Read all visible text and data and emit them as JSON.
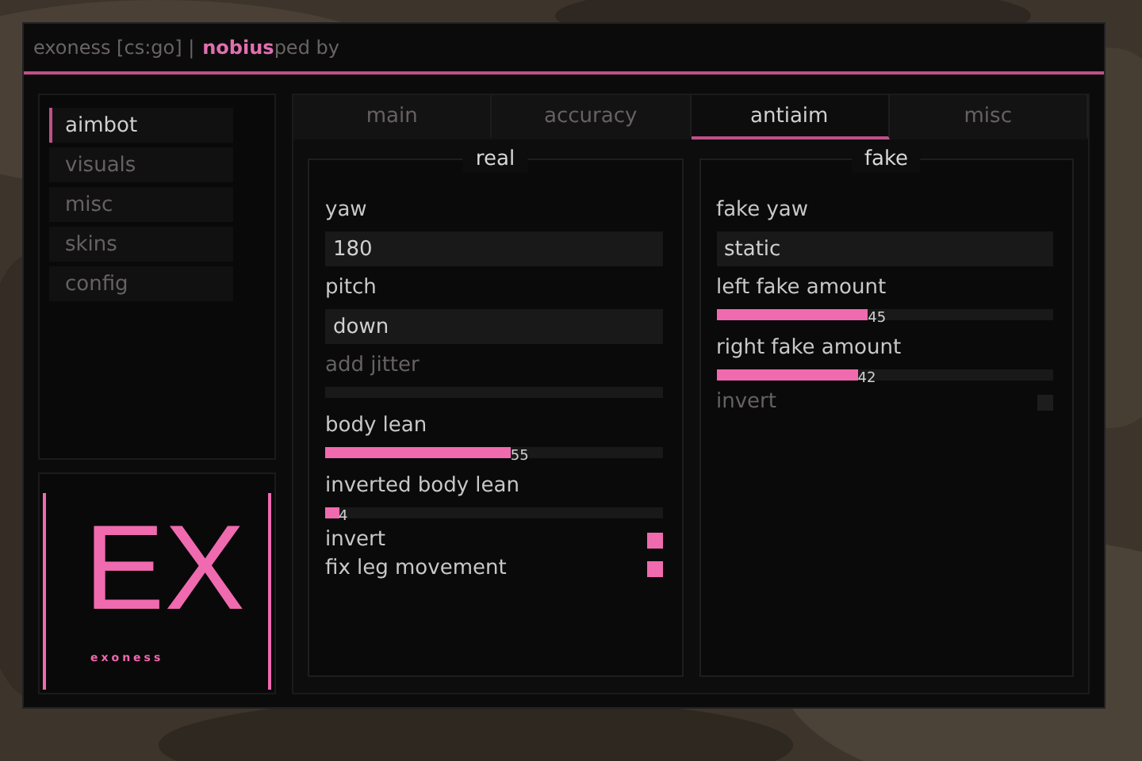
{
  "title": {
    "segments": [
      {
        "text": "exoness [cs:go] |",
        "highlight": false
      },
      {
        "text": "nobius",
        "highlight": true
      },
      {
        "text": "ped by",
        "highlight": false
      }
    ]
  },
  "sidebar": {
    "items": [
      {
        "label": "aimbot",
        "selected": true
      },
      {
        "label": "visuals",
        "selected": false
      },
      {
        "label": "misc",
        "selected": false
      },
      {
        "label": "skins",
        "selected": false
      },
      {
        "label": "config",
        "selected": false
      }
    ]
  },
  "logo": {
    "mark": "EX",
    "caption": "exoness"
  },
  "tabs": [
    {
      "label": "main",
      "selected": false
    },
    {
      "label": "accuracy",
      "selected": false
    },
    {
      "label": "antiaim",
      "selected": true
    },
    {
      "label": "misc",
      "selected": false
    }
  ],
  "groups": [
    {
      "title": "real",
      "controls": [
        {
          "kind": "combo",
          "label": "yaw",
          "value": "180",
          "disabled": false
        },
        {
          "kind": "combo",
          "label": "pitch",
          "value": "down",
          "disabled": false
        },
        {
          "kind": "slider",
          "label": "add jitter",
          "disabled": true
        },
        {
          "kind": "slider",
          "label": "body lean",
          "level": 0.55,
          "reading": "55",
          "disabled": false
        },
        {
          "kind": "slider",
          "label": "inverted body lean",
          "level": 0.04,
          "reading": "4",
          "disabled": false
        },
        {
          "kind": "checkbox",
          "label": "invert",
          "checked": true,
          "disabled": false
        },
        {
          "kind": "checkbox",
          "label": "fix leg movement",
          "checked": true,
          "disabled": false
        }
      ]
    },
    {
      "title": "fake",
      "controls": [
        {
          "kind": "combo",
          "label": "fake yaw",
          "value": "static",
          "disabled": false
        },
        {
          "kind": "slider",
          "label": "left fake amount",
          "level": 0.45,
          "reading": "45",
          "disabled": false
        },
        {
          "kind": "slider",
          "label": "right fake amount",
          "level": 0.42,
          "reading": "42",
          "disabled": false
        },
        {
          "kind": "checkbox",
          "label": "invert",
          "checked": false,
          "disabled": true
        }
      ]
    }
  ]
}
